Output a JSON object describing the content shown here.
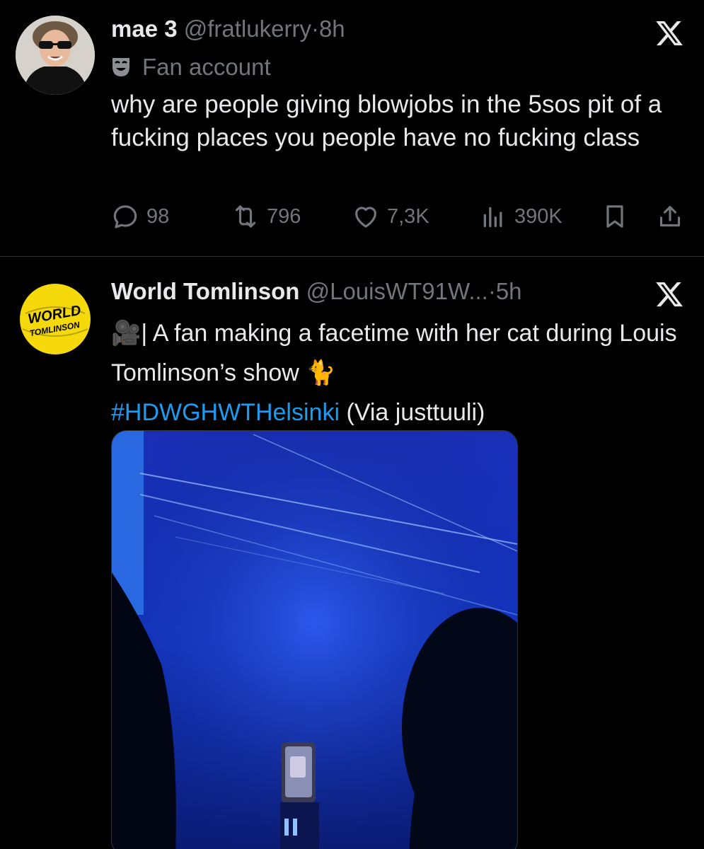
{
  "tweets": [
    {
      "name": "mae 3",
      "handle": "@fratlukerry",
      "separator": "·",
      "time": "8h",
      "label_icon": "theater-mask-icon",
      "label": "Fan account",
      "text": "why are people giving blowjobs in the 5sos pit of a fucking places you people have no fucking class",
      "replies": "98",
      "reposts": "796",
      "likes": "7,3K",
      "views": "390K"
    },
    {
      "name": "World Tomlinson",
      "handle": "@LouisWT91W...",
      "separator": "·",
      "time": "5h",
      "avatar_text": [
        "WORLD",
        "TOMLINSON"
      ],
      "text_prefix_emoji": "🎥",
      "text_main": "| A fan making a facetime with her cat during Louis Tomlinson’s show ",
      "text_emoji": "🐈",
      "hashtag": "#HDWGHWTHelsinki",
      "text_suffix": " (Via justtuuli)"
    }
  ],
  "colors": {
    "background": "#000000",
    "text": "#e7e9ea",
    "muted": "#71767b",
    "link": "#1d9bf0",
    "divider": "#2f3336",
    "avatar_yellow": "#f5d90a"
  }
}
